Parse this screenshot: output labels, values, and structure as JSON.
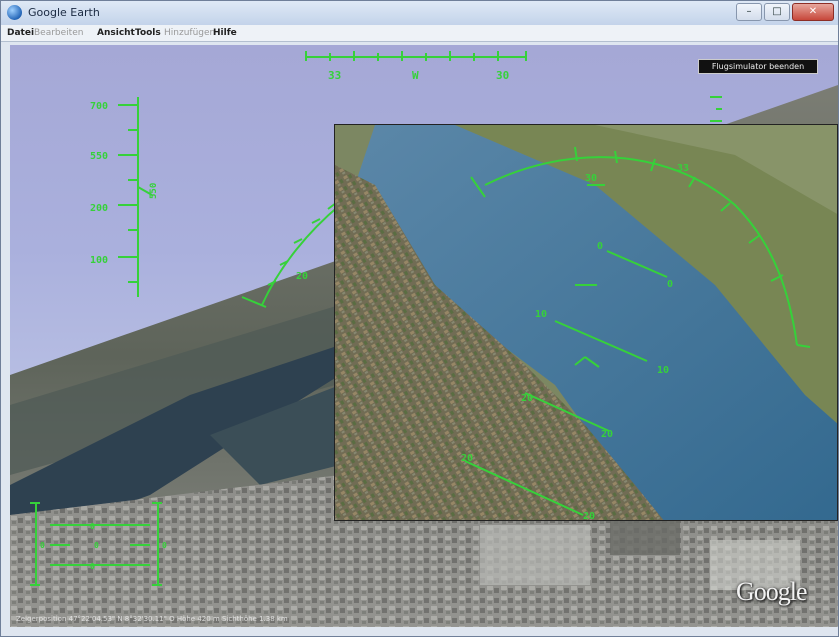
{
  "window": {
    "title": "Google Earth"
  },
  "menu": [
    {
      "label": "Datei",
      "enabled": true
    },
    {
      "label": "Bearbeiten",
      "enabled": false
    },
    {
      "label": "Ansicht",
      "enabled": true
    },
    {
      "label": "Tools",
      "enabled": true
    },
    {
      "label": "Hinzufügen",
      "enabled": false
    },
    {
      "label": "Hilfe",
      "enabled": true
    }
  ],
  "window_controls": {
    "minimize": "–",
    "maximize": "□",
    "close": "✕"
  },
  "hud": {
    "heading_labels": [
      "33",
      "W",
      "30"
    ],
    "altitude_labels": [
      "700",
      "550",
      "200",
      "100"
    ],
    "altitude_side_label": "550",
    "pitch_label": "20",
    "corner_labels": [
      "0",
      "0",
      "0",
      "0",
      "0"
    ]
  },
  "tooltip": {
    "text": "Flugsimulator beenden"
  },
  "inset": {
    "heading_labels": [
      "30",
      "33"
    ],
    "pitch_labels": [
      "0",
      "0",
      "10",
      "10",
      "20",
      "20",
      "20",
      "20"
    ]
  },
  "logo": {
    "text": "Google"
  },
  "statusbar": {
    "text": "Zeigerposition 47°22'04.53\" N 8°32'30.11\" O   Höhe 420 m   Sichthöhe 1.38 km"
  },
  "colors": {
    "hud": "#36d13a",
    "sky": "#a9aedd",
    "water": "#3f6c91"
  }
}
